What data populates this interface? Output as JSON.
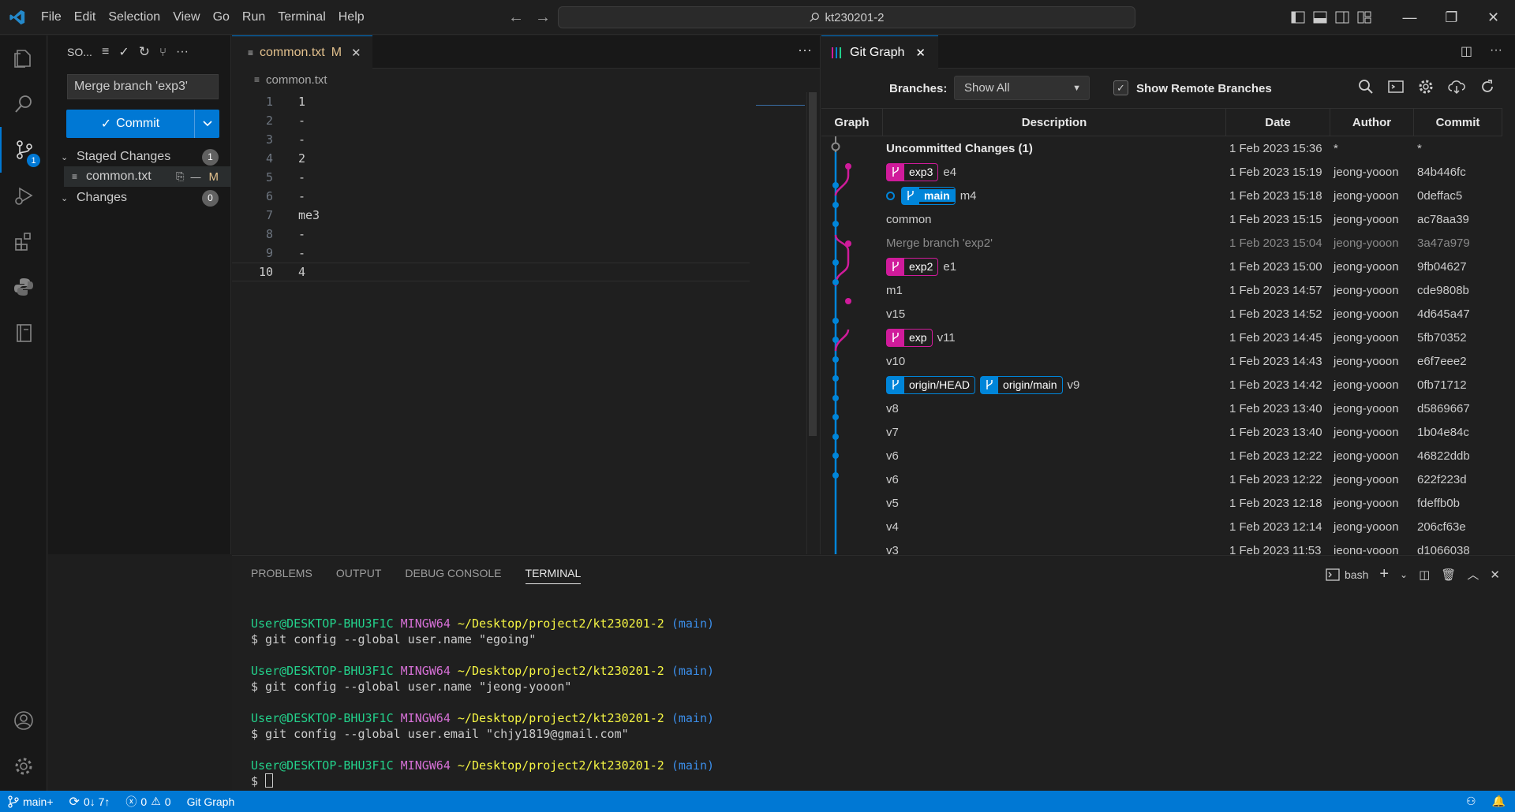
{
  "titlebar": {
    "menu": [
      "File",
      "Edit",
      "Selection",
      "View",
      "Go",
      "Run",
      "Terminal",
      "Help"
    ],
    "command_center": "kt230201-2"
  },
  "sidebar": {
    "title": "SO...",
    "commit_message": "Merge branch 'exp3'",
    "commit_label": "Commit",
    "staged": {
      "label": "Staged Changes",
      "count": "1"
    },
    "staged_file": {
      "name": "common.txt",
      "status": "M"
    },
    "changes": {
      "label": "Changes",
      "count": "0"
    },
    "scm_badge": "1"
  },
  "editor": {
    "tab_label": "common.txt",
    "tab_status": "M",
    "breadcrumb": "common.txt",
    "lines": [
      {
        "no": "1",
        "text": "1"
      },
      {
        "no": "2",
        "text": "-"
      },
      {
        "no": "3",
        "text": "-"
      },
      {
        "no": "4",
        "text": "2"
      },
      {
        "no": "5",
        "text": "-"
      },
      {
        "no": "6",
        "text": "-"
      },
      {
        "no": "7",
        "text": "me3"
      },
      {
        "no": "8",
        "text": "-"
      },
      {
        "no": "9",
        "text": "-"
      },
      {
        "no": "10",
        "text": "4"
      }
    ]
  },
  "gitgraph": {
    "tab_label": "Git Graph",
    "branches_label": "Branches:",
    "branches_value": "Show All",
    "remote_label": "Show Remote Branches",
    "columns": [
      "Graph",
      "Description",
      "Date",
      "Author",
      "Commit"
    ],
    "rows": [
      {
        "desc": "Uncommitted Changes (1)",
        "refs": [],
        "date": "1 Feb 2023 15:36",
        "author": "*",
        "commit": "*"
      },
      {
        "desc": "e4",
        "refs": [
          {
            "name": "exp3",
            "type": "pink"
          }
        ],
        "date": "1 Feb 2023 15:19",
        "author": "jeong-yooon",
        "commit": "84b446fc"
      },
      {
        "desc": "m4",
        "refs": [
          {
            "name": "main",
            "type": "head"
          }
        ],
        "date": "1 Feb 2023 15:18",
        "author": "jeong-yooon",
        "commit": "0deffac5"
      },
      {
        "desc": "common",
        "refs": [],
        "date": "1 Feb 2023 15:15",
        "author": "jeong-yooon",
        "commit": "ac78aa39"
      },
      {
        "desc": "Merge branch 'exp2'",
        "refs": [],
        "date": "1 Feb 2023 15:04",
        "author": "jeong-yooon",
        "commit": "3a47a979"
      },
      {
        "desc": "e1",
        "refs": [
          {
            "name": "exp2",
            "type": "pink"
          }
        ],
        "date": "1 Feb 2023 15:00",
        "author": "jeong-yooon",
        "commit": "9fb04627"
      },
      {
        "desc": "m1",
        "refs": [],
        "date": "1 Feb 2023 14:57",
        "author": "jeong-yooon",
        "commit": "cde9808b"
      },
      {
        "desc": "v15",
        "refs": [],
        "date": "1 Feb 2023 14:52",
        "author": "jeong-yooon",
        "commit": "4d645a47"
      },
      {
        "desc": "v11",
        "refs": [
          {
            "name": "exp",
            "type": "pink"
          }
        ],
        "date": "1 Feb 2023 14:45",
        "author": "jeong-yooon",
        "commit": "5fb70352"
      },
      {
        "desc": "v10",
        "refs": [],
        "date": "1 Feb 2023 14:43",
        "author": "jeong-yooon",
        "commit": "e6f7eee2"
      },
      {
        "desc": "v9",
        "refs": [
          {
            "name": "origin/HEAD",
            "type": "blue"
          },
          {
            "name": "origin/main",
            "type": "blue"
          }
        ],
        "date": "1 Feb 2023 14:42",
        "author": "jeong-yooon",
        "commit": "0fb71712"
      },
      {
        "desc": "v8",
        "refs": [],
        "date": "1 Feb 2023 13:40",
        "author": "jeong-yooon",
        "commit": "d5869667"
      },
      {
        "desc": "v7",
        "refs": [],
        "date": "1 Feb 2023 13:40",
        "author": "jeong-yooon",
        "commit": "1b04e84c"
      },
      {
        "desc": "v6",
        "refs": [],
        "date": "1 Feb 2023 12:22",
        "author": "jeong-yooon",
        "commit": "46822ddb"
      },
      {
        "desc": "v6",
        "refs": [],
        "date": "1 Feb 2023 12:22",
        "author": "jeong-yooon",
        "commit": "622f223d"
      },
      {
        "desc": "v5",
        "refs": [],
        "date": "1 Feb 2023 12:18",
        "author": "jeong-yooon",
        "commit": "fdeffb0b"
      },
      {
        "desc": "v4",
        "refs": [],
        "date": "1 Feb 2023 12:14",
        "author": "jeong-yooon",
        "commit": "206cf63e"
      },
      {
        "desc": "v3",
        "refs": [],
        "date": "1 Feb 2023 11:53",
        "author": "jeong-yooon",
        "commit": "d1066038"
      }
    ]
  },
  "panel": {
    "tabs": [
      "PROBLEMS",
      "OUTPUT",
      "DEBUG CONSOLE",
      "TERMINAL"
    ],
    "shell": "bash",
    "prompt": {
      "user": "User@DESKTOP-BHU3F1C",
      "sys": "MINGW64",
      "path": "~/Desktop/project2/kt230201-2",
      "branch": "(main)"
    },
    "commands": [
      "$ git config --global user.name \"egoing\"",
      "$ git config --global user.name \"jeong-yooon\"",
      "$ git config --global user.email \"chjy1819@gmail.com\"",
      "$ "
    ]
  },
  "status": {
    "branch": "main+",
    "sync": "0↓ 7↑",
    "errors": "0",
    "warnings": "0",
    "gitgraph": "Git Graph"
  },
  "colors": {
    "accent": "#0078d4",
    "pink": "#d01b9b",
    "blue": "#0085d9"
  }
}
